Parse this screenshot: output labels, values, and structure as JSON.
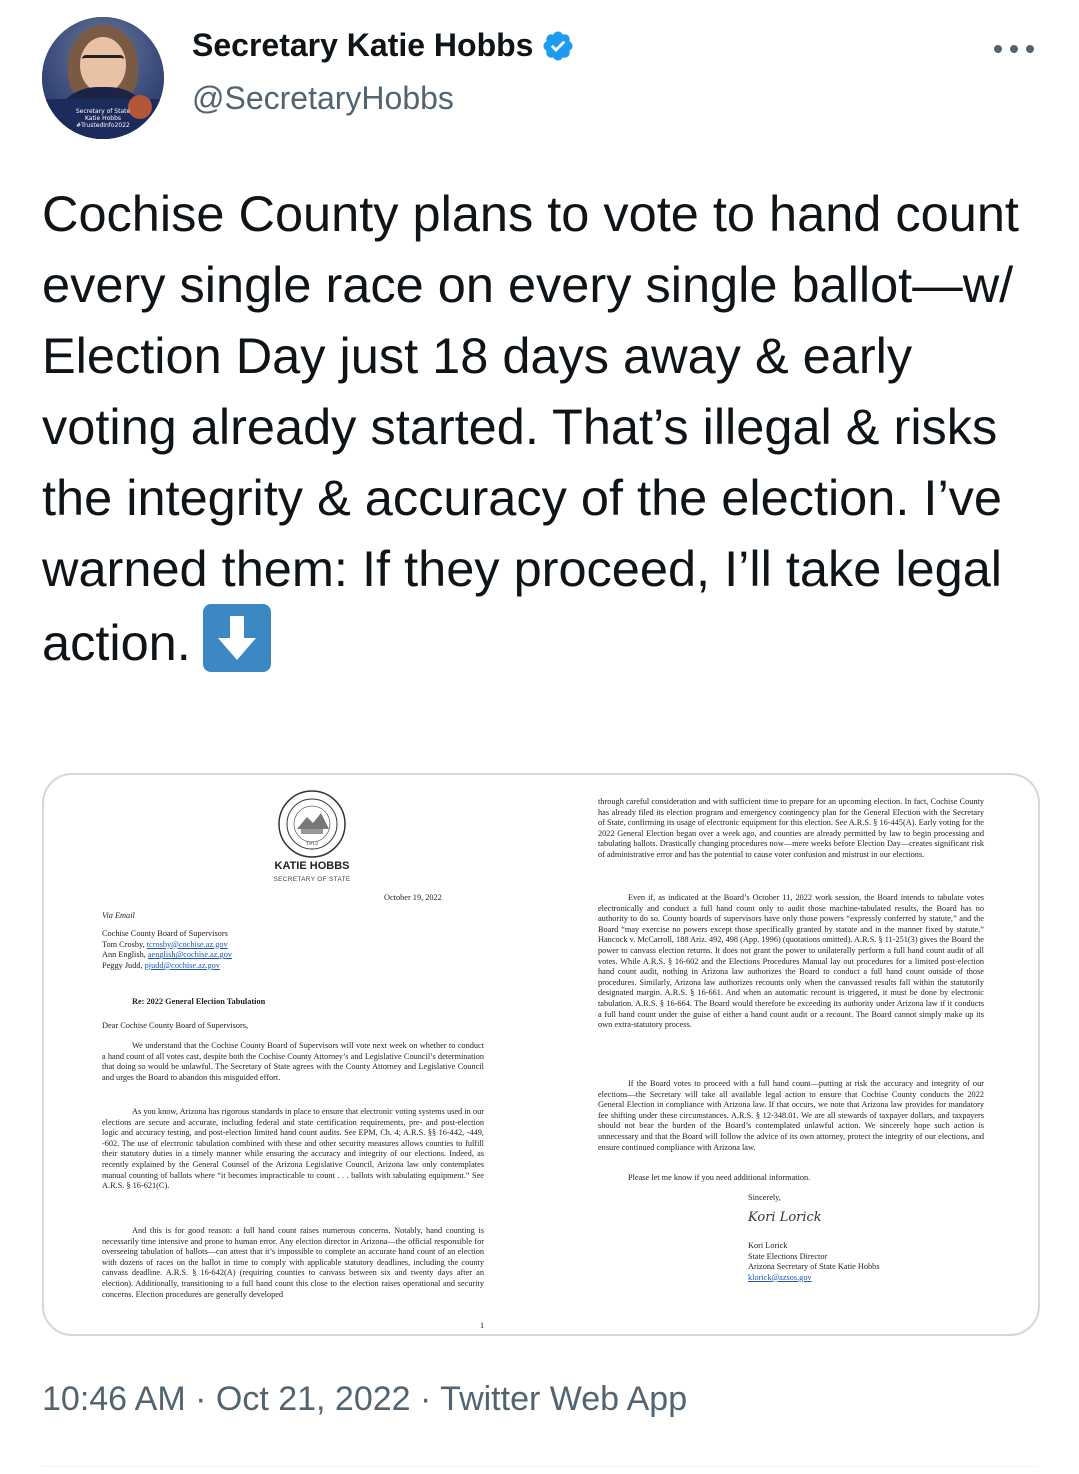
{
  "author": {
    "display_name": "Secretary Katie Hobbs",
    "handle": "@SecretaryHobbs",
    "verified": true,
    "avatar_caption": [
      "Secretary of State",
      "Katie Hobbs",
      "#TrustedInfo2022"
    ]
  },
  "tweet": {
    "text": "Cochise County plans to vote to hand count every single race on every single ballot—w/ Election Day just 18 days away & early voting already started. That’s illegal & risks the integrity & accuracy of the election. I’ve warned them: If they proceed, I’ll take legal action.",
    "emoji": "down-arrow-emoji"
  },
  "document": {
    "letterhead_name": "KATIE HOBBS",
    "letterhead_title": "SECRETARY OF STATE",
    "date": "October 19, 2022",
    "via": "Via Email",
    "address": [
      "Cochise County Board of Supervisors",
      "Tom Crosby, ",
      "Ann English, ",
      "Peggy Judd, "
    ],
    "emails": [
      "tcrosby@cochise.az.gov",
      "aenglish@cochise.az.gov",
      "pjudd@cochise.az.gov"
    ],
    "re": "Re: 2022 General Election Tabulation",
    "salutation": "Dear Cochise County Board of Supervisors,",
    "left_paragraphs": [
      "We understand that the Cochise County Board of Supervisors will vote next week on whether to conduct a hand count of all votes cast, despite both the Cochise County Attorney’s and Legislative Council’s determination that doing so would be unlawful. The Secretary of State agrees with the County Attorney and Legislative Council and urges the Board to abandon this misguided effort.",
      "As you know, Arizona has rigorous standards in place to ensure that electronic voting systems used in our elections are secure and accurate, including federal and state certification requirements, pre- and post-election logic and accuracy testing, and post-election limited hand count audits. See EPM, Ch. 4; A.R.S. §§ 16-442, -449, -602. The use of electronic tabulation combined with these and other security measures allows counties to fulfill their statutory duties in a timely manner while ensuring the accuracy and integrity of our elections. Indeed, as recently explained by the General Counsel of the Arizona Legislative Council, Arizona law only contemplates manual counting of ballots where “it becomes impracticable to count . . . ballots with tabulating equipment.” See A.R.S. § 16-621(C).",
      "And this is for good reason: a full hand count raises numerous concerns. Notably, hand counting is necessarily time intensive and prone to human error. Any election director in Arizona—the official responsible for overseeing tabulation of ballots—can attest that it’s impossible to complete an accurate hand count of an election with dozens of races on the ballot in time to comply with applicable statutory deadlines, including the county canvass deadline. A.R.S. § 16-642(A) (requiring counties to canvass between six and twenty days after an election). Additionally, transitioning to a full hand count this close to the election raises operational and security concerns. Election procedures are generally developed"
    ],
    "page_number": "1",
    "right_paragraphs": [
      "through careful consideration and with sufficient time to prepare for an upcoming election. In fact, Cochise County has already filed its election program and emergency contingency plan for the General Election with the Secretary of State, confirming its usage of electronic equipment for this election. See A.R.S. § 16-445(A). Early voting for the 2022 General Election began over a week ago, and counties are already permitted by law to begin processing and tabulating ballots. Drastically changing procedures now—mere weeks before Election Day—creates significant risk of administrative error and has the potential to cause voter confusion and mistrust in our elections.",
      "Even if, as indicated at the Board’s October 11, 2022 work session, the Board intends to tabulate votes electronically and conduct a full hand count only to audit those machine-tabulated results, the Board has no authority to do so. County boards of supervisors have only those powers “expressly conferred by statute,” and the Board “may exercise no powers except those specifically granted by statute and in the manner fixed by statute.” Hancock v. McCarroll, 188 Ariz. 492, 498 (App. 1996) (quotations omitted). A.R.S. § 11-251(3) gives the Board the power to canvass election returns. It does not grant the power to unilaterally perform a full hand count audit of all votes. While A.R.S. § 16-602 and the Elections Procedures Manual lay out procedures for a limited post-election hand count audit, nothing in Arizona law authorizes the Board to conduct a full hand count outside of those procedures. Similarly, Arizona law authorizes recounts only when the canvassed results fall within the statutorily designated margin. A.R.S. § 16-661. And when an automatic recount is triggered, it must be done by electronic tabulation. A.R.S. § 16-664. The Board would therefore be exceeding its authority under Arizona law if it conducts a full hand count under the guise of either a hand count audit or a recount. The Board cannot simply make up its own extra-statutory process.",
      "If the Board votes to proceed with a full hand count—putting at risk the accuracy and integrity of our elections—the Secretary will take all available legal action to ensure that Cochise County conducts the 2022 General Election in compliance with Arizona law. If that occurs, we note that Arizona law provides for mandatory fee shifting under these circumstances. A.R.S. § 12-348.01. We are all stewards of taxpayer dollars, and taxpayers should not bear the burden of the Board’s contemplated unlawful action. We sincerely hope such action is unnecessary and that the Board will follow the advice of its own attorney, protect the integrity of our elections, and ensure continued compliance with Arizona law.",
      "Please let me know if you need additional information."
    ],
    "closing": "Sincerely,",
    "signature": "Kori Lorick",
    "signer": [
      "Kori Lorick",
      "State Elections Director",
      "Arizona Secretary of State Katie Hobbs"
    ],
    "signer_email": "klorick@azsos.gov"
  },
  "meta": {
    "time": "10:46 AM",
    "separator": " · ",
    "date": "Oct 21, 2022",
    "source": "Twitter Web App"
  },
  "colors": {
    "text": "#0f1419",
    "secondary": "#536471",
    "verified": "#1d9bf0",
    "card_border": "#cfd9de",
    "emoji_bg": "#3b88c3"
  }
}
